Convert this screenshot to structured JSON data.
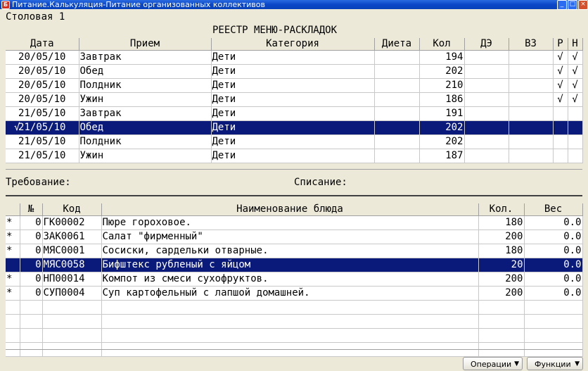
{
  "window": {
    "title": "Питание.Калькуляция-Питание организованных коллективов",
    "icon_text": "Б"
  },
  "location": "Столовая 1",
  "registry_title": "РЕЕСТР МЕНЮ-РАСКЛАДОК",
  "menu_table": {
    "headers": {
      "date": "Дата",
      "meal": "Прием",
      "category": "Категория",
      "diet": "Диета",
      "qty": "Кол",
      "de": "ДЭ",
      "vz": "ВЗ",
      "r": "Р",
      "n": "Н"
    },
    "rows": [
      {
        "mark": "",
        "date": "20/05/10",
        "meal": "Завтрак",
        "category": "Дети",
        "diet": "",
        "qty": "194",
        "de": "",
        "vz": "",
        "r": "√",
        "n": "√"
      },
      {
        "mark": "",
        "date": "20/05/10",
        "meal": "Обед",
        "category": "Дети",
        "diet": "",
        "qty": "202",
        "de": "",
        "vz": "",
        "r": "√",
        "n": "√"
      },
      {
        "mark": "",
        "date": "20/05/10",
        "meal": "Полдник",
        "category": "Дети",
        "diet": "",
        "qty": "210",
        "de": "",
        "vz": "",
        "r": "√",
        "n": "√"
      },
      {
        "mark": "",
        "date": "20/05/10",
        "meal": "Ужин",
        "category": "Дети",
        "diet": "",
        "qty": "186",
        "de": "",
        "vz": "",
        "r": "√",
        "n": "√"
      },
      {
        "mark": "",
        "date": "21/05/10",
        "meal": "Завтрак",
        "category": "Дети",
        "diet": "",
        "qty": "191",
        "de": "",
        "vz": "",
        "r": "",
        "n": ""
      },
      {
        "mark": "√",
        "date": "21/05/10",
        "meal": "Обед",
        "category": "Дети",
        "diet": "",
        "qty": "202",
        "de": "",
        "vz": "",
        "r": "",
        "n": "",
        "selected": true
      },
      {
        "mark": "",
        "date": "21/05/10",
        "meal": "Полдник",
        "category": "Дети",
        "diet": "",
        "qty": "202",
        "de": "",
        "vz": "",
        "r": "",
        "n": ""
      },
      {
        "mark": "",
        "date": "21/05/10",
        "meal": "Ужин",
        "category": "Дети",
        "diet": "",
        "qty": "187",
        "de": "",
        "vz": "",
        "r": "",
        "n": ""
      }
    ]
  },
  "requirement_label": "Требование:",
  "writeoff_label": "Списание:",
  "dish_table": {
    "headers": {
      "star": "",
      "num": "№",
      "code": "Код",
      "name": "Наименование блюда",
      "qty": "Кол.",
      "weight": "Вес"
    },
    "rows": [
      {
        "star": "*",
        "num": "0",
        "code": "ГК00002",
        "name": "Пюре гороховое.",
        "qty": "180",
        "weight": "0.0"
      },
      {
        "star": "*",
        "num": "0",
        "code": "ЗАК0061",
        "name": "Салат \"фирменный\"",
        "qty": "200",
        "weight": "0.0"
      },
      {
        "star": "*",
        "num": "0",
        "code": "МЯС0001",
        "name": "Сосиски, сардельки отварные.",
        "qty": "180",
        "weight": "0.0"
      },
      {
        "star": "",
        "num": "0",
        "code": "МЯС0058",
        "name": "Бифштекс рубленый с яйцом",
        "qty": "20",
        "weight": "0.0",
        "selected": true
      },
      {
        "star": "*",
        "num": "0",
        "code": "НП00014",
        "name": "Компот из смеси сухофруктов.",
        "qty": "200",
        "weight": "0.0"
      },
      {
        "star": "*",
        "num": "0",
        "code": "СУП0004",
        "name": "Суп картофельный с лапшой домашней.",
        "qty": "200",
        "weight": "0.0"
      },
      {
        "star": "",
        "num": "",
        "code": "",
        "name": "",
        "qty": "",
        "weight": ""
      },
      {
        "star": "",
        "num": "",
        "code": "",
        "name": "",
        "qty": "",
        "weight": ""
      },
      {
        "star": "",
        "num": "",
        "code": "",
        "name": "",
        "qty": "",
        "weight": ""
      },
      {
        "star": "",
        "num": "",
        "code": "",
        "name": "",
        "qty": "",
        "weight": ""
      }
    ]
  },
  "buttons": {
    "operations": "Операции",
    "functions": "Функции"
  },
  "colors": {
    "selection": "#0a1a7a",
    "titlebar": "#0a47c8",
    "background": "#ECE9D8"
  }
}
